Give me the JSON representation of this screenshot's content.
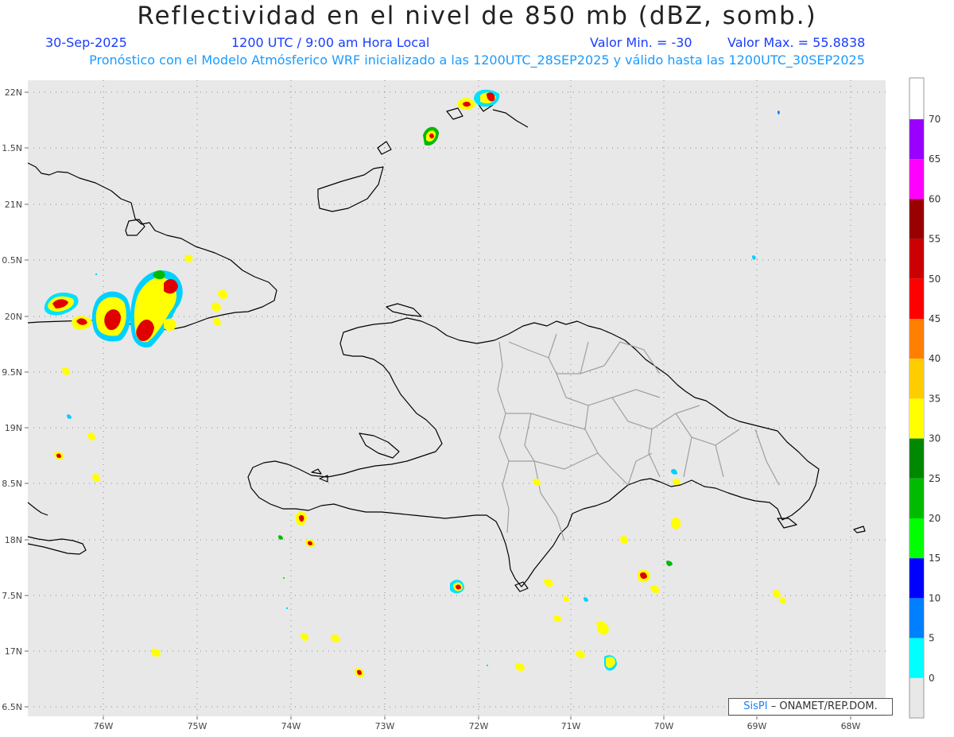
{
  "title": "Reflectividad en el nivel de 850 mb (dBZ, somb.)",
  "date": "30-Sep-2025",
  "time": "1200 UTC / 9:00 am Hora Local",
  "min_label": "Valor Min. = -30",
  "max_label": "Valor Max. = 55.8838",
  "subtitle": "Pronóstico con el Modelo Atmósferico WRF inicializado a las 1200UTC_28SEP2025 y válido hasta las  1200UTC_30SEP2025",
  "credit": {
    "brand": "SisPI",
    "rest": " – ONAMET/REP.DOM."
  },
  "lat_labels": [
    "22N",
    "1.5N",
    "21N",
    "0.5N",
    "20N",
    "9.5N",
    "19N",
    "8.5N",
    "18N",
    "7.5N",
    "17N",
    "6.5N"
  ],
  "lon_labels": [
    "76W",
    "75W",
    "74W",
    "73W",
    "72W",
    "71W",
    "70W",
    "69W",
    "68W"
  ],
  "colorbar": {
    "labels": [
      "70",
      "65",
      "60",
      "55",
      "50",
      "45",
      "40",
      "35",
      "30",
      "25",
      "20",
      "15",
      "10",
      "5",
      "0"
    ],
    "colors": [
      "#9900ff",
      "#ff00ff",
      "#990000",
      "#cc0000",
      "#ff0000",
      "#ff8000",
      "#ffcc00",
      "#ffff00",
      "#008800",
      "#00bb00",
      "#00ff00",
      "#0000ff",
      "#0080ff",
      "#00ffff"
    ]
  },
  "colors": {
    "map_bg": "#e8e8e8",
    "coast": "#000000",
    "provinces": "#999999",
    "header_blue": "#1a3cff",
    "subtitle_cyan": "#1a9bff"
  }
}
